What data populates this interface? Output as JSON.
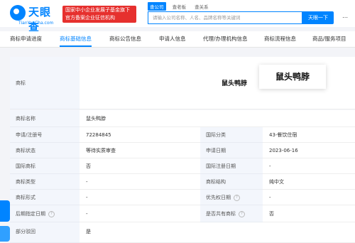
{
  "header": {
    "logo_text": "天眼查",
    "logo_sub": "TianYanCha.com",
    "promo_line1": "国家中小企业发展子基金旗下",
    "promo_line2": "官方备案企业征信机构",
    "search_tabs": [
      "查公司",
      "查老板",
      "查关系"
    ],
    "search_placeholder": "请输入公司名称、人名、品牌名称等关键词",
    "search_button": "天眼一下"
  },
  "tabs": [
    "商标申请进度",
    "商标基础信息",
    "商标公告信息",
    "申请人信息",
    "代理/办理机构信息",
    "商标流程信息",
    "商品/服务项目"
  ],
  "active_tab": 1,
  "trademark": {
    "label": "商标",
    "image_text_small": "鼠头鸭脖",
    "image_text_large": "鼠头鸭脖"
  },
  "rows": [
    {
      "l1": "商标名称",
      "v1": "鼠头鸭脖"
    },
    {
      "l1": "申请/注册号",
      "v1": "72284845",
      "l2": "国际分类",
      "v2": "43-餐饮住宿"
    },
    {
      "l1": "商标状态",
      "v1": "等待实质审查",
      "l2": "申请日期",
      "v2": "2023-06-16"
    },
    {
      "l1": "国际商标",
      "v1": "否",
      "l2": "国际注册日期",
      "v2": "-"
    },
    {
      "l1": "商标类型",
      "v1": "-",
      "l2": "商标结构",
      "v2": "纯中文"
    },
    {
      "l1": "商标形式",
      "v1": "-",
      "l2": "优先权日期",
      "v2": "-"
    },
    {
      "l1": "后期指定日期",
      "v1": "-",
      "l2": "是否共有商标",
      "v2": "否"
    },
    {
      "l1": "部分驳回",
      "v1": "是"
    }
  ]
}
